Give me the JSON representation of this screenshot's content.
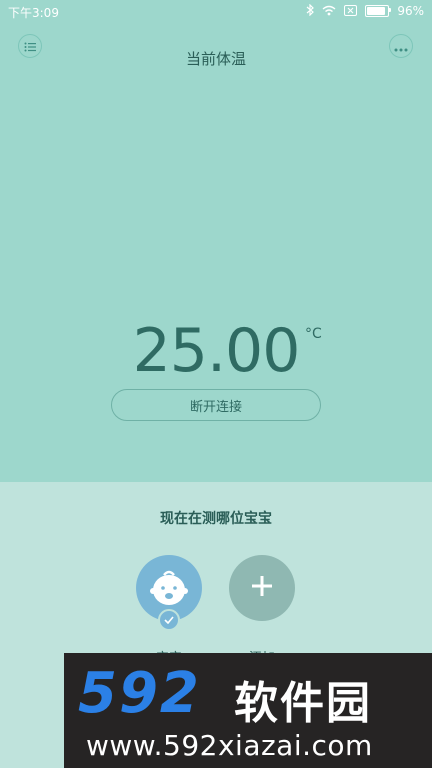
{
  "status_bar": {
    "time": "下午3:09",
    "battery_percent": "96%",
    "battery_level": 0.96,
    "icons": [
      "bluetooth-icon",
      "wifi-icon",
      "sim-icon",
      "battery-icon"
    ]
  },
  "header": {
    "title": "当前体温",
    "left_icon": "list-icon",
    "right_icon": "more-icon"
  },
  "temperature": {
    "value": "25.00",
    "unit": "°C"
  },
  "actions": {
    "disconnect_label": "断开连接"
  },
  "baby_section": {
    "title": "现在在测哪位宝宝",
    "profiles": [
      {
        "label": "宝宝",
        "selected": true
      }
    ],
    "add_label": "添加"
  },
  "colors": {
    "top_background": "#9dd7cc",
    "bottom_background": "#bfe3dc",
    "accent": "#2f6b63",
    "avatar": "#79b6d6",
    "add_button": "#8fb8b2"
  },
  "watermark": {
    "logo_number": "592",
    "logo_text": "软件园",
    "url": "www.592xiazai.com"
  }
}
